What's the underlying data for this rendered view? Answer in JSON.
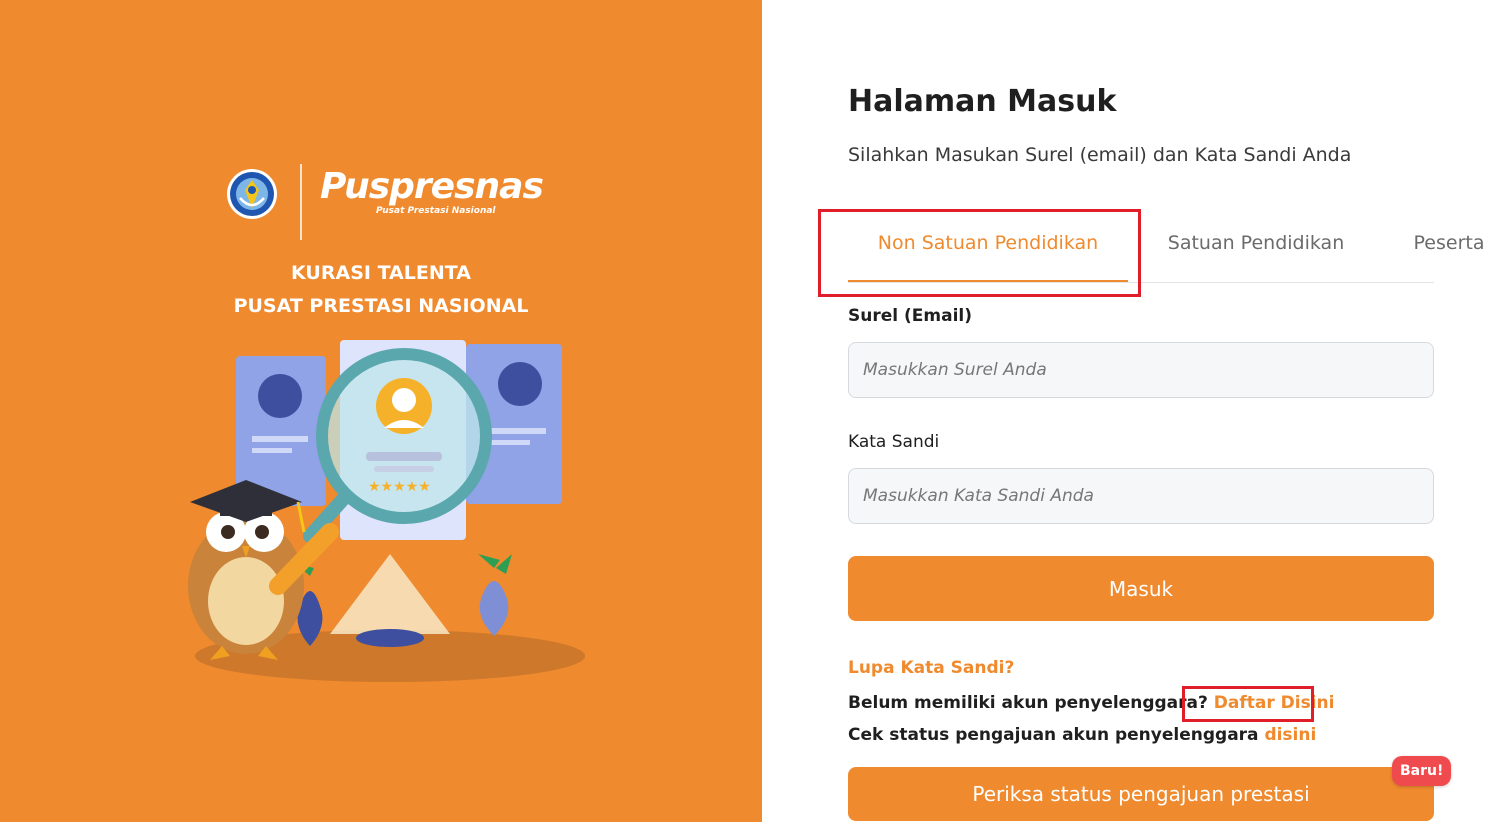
{
  "brand": {
    "name": "Puspresnas",
    "sub": "Pusat Prestasi Nasional",
    "tagline_line1": "KURASI TALENTA",
    "tagline_line2": "PUSAT PRESTASI NASIONAL"
  },
  "colors": {
    "accent": "#ef8a2e",
    "highlight": "#e11d2a",
    "badge": "#ef4b4f"
  },
  "login": {
    "title": "Halaman Masuk",
    "subtitle": "Silahkan Masukan Surel (email) dan Kata Sandi Anda",
    "tabs": [
      {
        "label": "Non Satuan Pendidikan",
        "active": true
      },
      {
        "label": "Satuan Pendidikan",
        "active": false
      },
      {
        "label": "Peserta",
        "active": false
      }
    ],
    "email_label": "Surel (Email)",
    "email_placeholder": "Masukkan Surel Anda",
    "password_label": "Kata Sandi",
    "password_placeholder": "Masukkan Kata Sandi Anda",
    "submit_label": "Masuk",
    "forgot_label": "Lupa Kata Sandi?",
    "register_prompt": "Belum memiliki akun penyelenggara?",
    "register_link": "Daftar Disini",
    "status_prompt": "Cek status pengajuan akun penyelenggara",
    "status_link": "disini",
    "check_button": "Periksa status pengajuan prestasi",
    "badge": "Baru!"
  }
}
